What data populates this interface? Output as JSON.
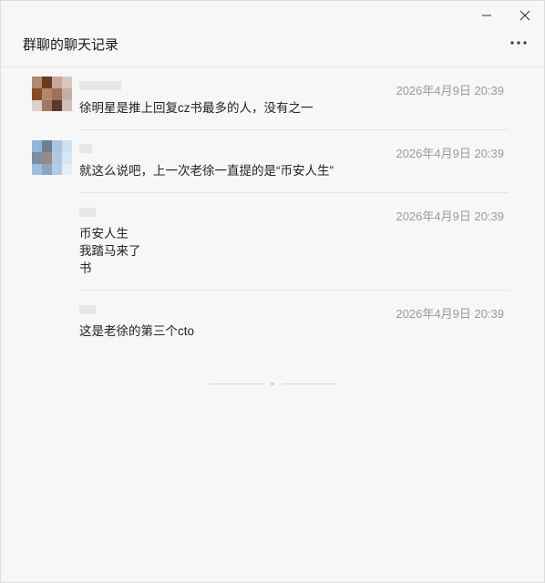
{
  "window": {
    "title": "群聊的聊天记录",
    "minimize_icon": "minimize-icon",
    "close_icon": "close-icon",
    "more_icon": "more-horizontal-icon"
  },
  "messages": [
    {
      "timestamp": "2026年4月9日 20:39",
      "lines": [
        "徐明星是推上回复cz书最多的人，没有之一"
      ],
      "avatar_colors": [
        "#b08a72",
        "#6b3a1f",
        "#c9a898",
        "#d8c8c0",
        "#8a4a22",
        "#b2886c",
        "#a07058",
        "#c4b0a4",
        "#e0d0c8",
        "#9c7a66",
        "#5a3a2a",
        "#d0c0b8"
      ]
    },
    {
      "timestamp": "2026年4月9日 20:39",
      "lines": [
        "就这么说吧，上一次老徐一直提的是“币安人生”"
      ],
      "avatar_colors": [
        "#8fb6dc",
        "#6d7f92",
        "#a9c4de",
        "#cde0f0",
        "#7c8ea3",
        "#9a8a84",
        "#b0c8e0",
        "#d7e6f3",
        "#9cc0e2",
        "#8aa4c2",
        "#b3cce6",
        "#e3eef8"
      ]
    },
    {
      "timestamp": "2026年4月9日 20:39",
      "lines": [
        "币安人生",
        "我踏马来了",
        "书"
      ]
    },
    {
      "timestamp": "2026年4月9日 20:39",
      "lines": [
        "这是老徐的第三个cto"
      ]
    }
  ]
}
